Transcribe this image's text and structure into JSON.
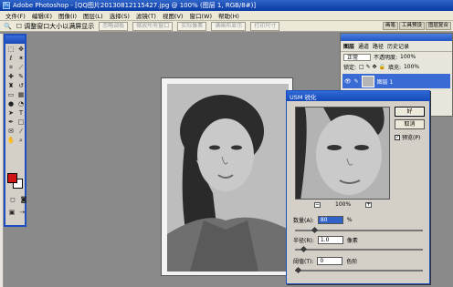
{
  "window": {
    "title": "Adobe Photoshop - [QQ图片20130812115427.jpg @ 100% (图层 1, RGB/8#)]"
  },
  "menu": [
    "文件(F)",
    "编辑(E)",
    "图像(I)",
    "图层(L)",
    "选择(S)",
    "滤镜(T)",
    "视图(V)",
    "窗口(W)",
    "帮助(H)"
  ],
  "options": {
    "resize_windows": "调整窗口大小以满屏显示",
    "ignore_palettes": "忽略调板",
    "zoom_all": "缩放所有窗口",
    "actual_pixels": "实际像素",
    "fit_screen": "满画布显示",
    "print_size": "打印尺寸"
  },
  "palette_well": [
    "画笔",
    "工具预设",
    "图层复合"
  ],
  "layers": {
    "tabs": [
      "图层",
      "通道",
      "路径",
      "历史记录"
    ],
    "blend": "正常",
    "opacity_label": "不透明度:",
    "opacity": "100%",
    "lock_label": "锁定:",
    "fill_label": "填充:",
    "fill": "100%",
    "layer_name": "图层 1"
  },
  "dialog": {
    "title": "USM 锐化",
    "ok": "好",
    "cancel": "取消",
    "preview_label": "预览(P)",
    "zoom": "100%",
    "zoom_minus": "−",
    "zoom_plus": "+",
    "amount_label": "数量(A):",
    "amount_value": "80",
    "amount_unit": "%",
    "radius_label": "半径(R):",
    "radius_value": "1.0",
    "radius_unit": "像素",
    "threshold_label": "阈值(T):",
    "threshold_value": "0",
    "threshold_unit": "色阶"
  },
  "colors": {
    "foreground": "#d21414",
    "background": "#ffffff",
    "accent": "#1d4ec2"
  },
  "tools": [
    "marquee-icon",
    "move-icon",
    "lasso-icon",
    "magic-wand-icon",
    "crop-icon",
    "slice-icon",
    "healing-icon",
    "brush-icon",
    "stamp-icon",
    "history-brush-icon",
    "eraser-icon",
    "gradient-icon",
    "blur-icon",
    "dodge-icon",
    "path-select-icon",
    "type-icon",
    "pen-icon",
    "shape-icon",
    "notes-icon",
    "eyedropper-icon",
    "hand-icon",
    "zoom-icon"
  ]
}
